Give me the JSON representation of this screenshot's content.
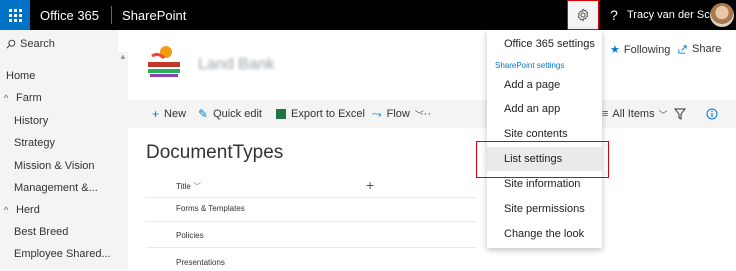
{
  "suite": {
    "title": "Office 365",
    "app": "SharePoint",
    "help_glyph": "?",
    "user_name": "Tracy van der Sc..."
  },
  "icons": {
    "waffle": "waffle-icon",
    "gear": "gear-icon",
    "help": "help-icon",
    "search": "search-icon"
  },
  "nav": {
    "search_label": "Search",
    "items": [
      {
        "label": "Home",
        "chevron": ""
      },
      {
        "label": "Farm",
        "chevron": "^"
      },
      {
        "label": "History",
        "chevron": ""
      },
      {
        "label": "Strategy",
        "chevron": ""
      },
      {
        "label": "Mission & Vision",
        "chevron": ""
      },
      {
        "label": "Management &...",
        "chevron": ""
      },
      {
        "label": "Herd",
        "chevron": "^"
      },
      {
        "label": "Best Breed",
        "chevron": ""
      },
      {
        "label": "Employee Shared...",
        "chevron": ""
      }
    ]
  },
  "site": {
    "name": "Land Bank",
    "following": "Following",
    "share": "Share"
  },
  "commands": {
    "new": "New",
    "quick_edit": "Quick edit",
    "export": "Export to Excel",
    "flow": "Flow",
    "more": "···",
    "view": "All Items"
  },
  "list": {
    "title": "DocumentTypes",
    "column": "Title",
    "add_column_glyph": "+",
    "rows": [
      "Forms & Templates",
      "Policies",
      "Presentations"
    ]
  },
  "menu": {
    "office_settings": "Office 365 settings",
    "section_label": "SharePoint settings",
    "items": [
      "Add a page",
      "Add an app",
      "Site contents",
      "List settings",
      "Site information",
      "Site permissions",
      "Change the look"
    ],
    "highlighted": "List settings"
  },
  "colors": {
    "suitebar": "#000000",
    "waffle": "#0072c6",
    "accent": "#0078d4",
    "highlight_border": "#dd0000"
  }
}
